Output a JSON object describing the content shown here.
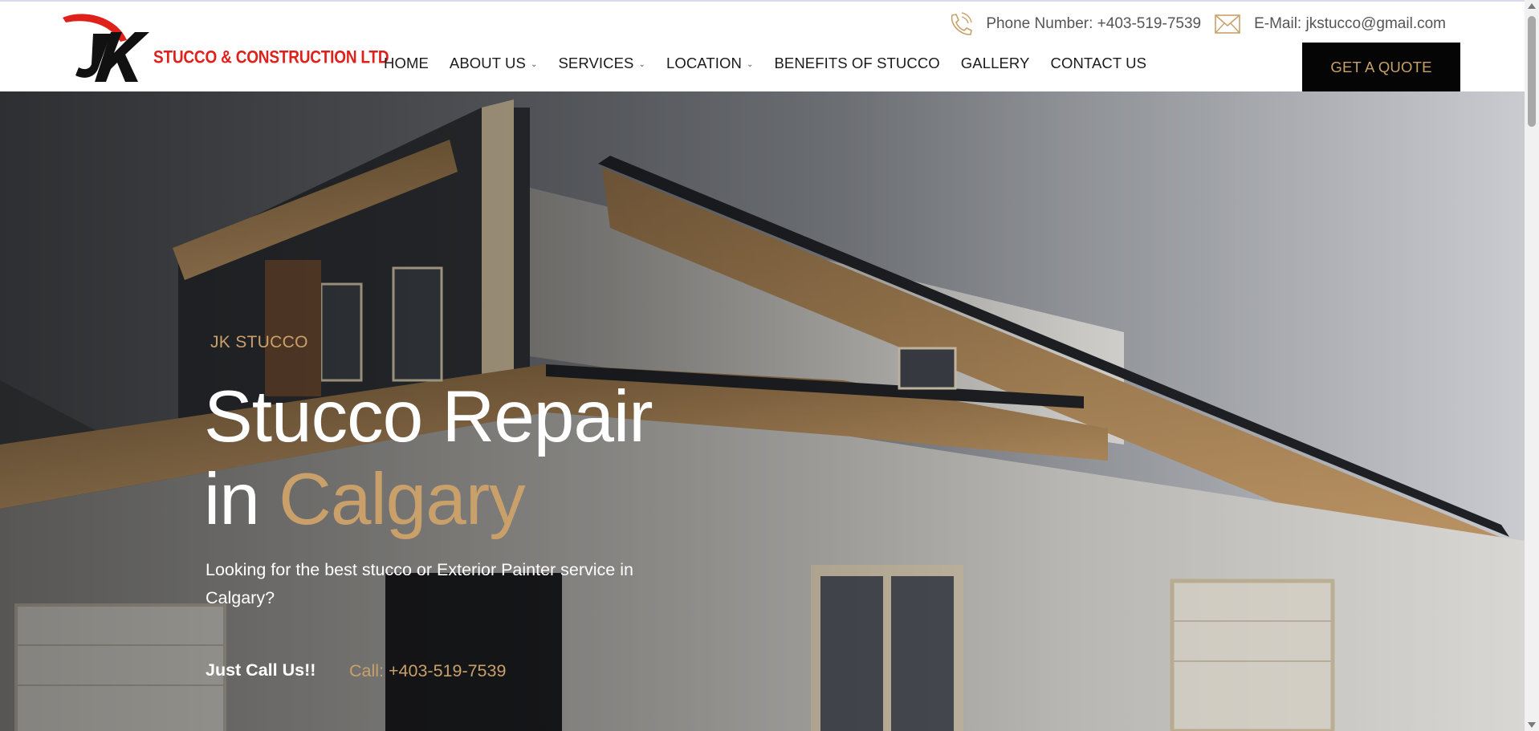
{
  "brand": {
    "logo_letters": "JK",
    "logo_tagline": "STUCCO & CONSTRUCTION LTD",
    "logo_color": "#e0211b"
  },
  "topbar": {
    "phone_icon": "phone-icon",
    "phone_text": "Phone Number: +403-519-7539",
    "email_icon": "mail-icon",
    "email_text": "E-Mail: jkstucco@gmail.com"
  },
  "nav": {
    "items": [
      {
        "label": "HOME",
        "dropdown": false
      },
      {
        "label": "ABOUT US",
        "dropdown": true
      },
      {
        "label": "SERVICES",
        "dropdown": true
      },
      {
        "label": "LOCATION",
        "dropdown": true
      },
      {
        "label": "BENEFITS OF STUCCO",
        "dropdown": false
      },
      {
        "label": "GALLERY",
        "dropdown": false
      },
      {
        "label": "CONTACT US",
        "dropdown": false
      }
    ],
    "cta_label": "GET A QUOTE"
  },
  "hero": {
    "eyebrow": "JK STUCCO",
    "headline_line1": "Stucco Repair",
    "headline_line2_prefix": "in ",
    "headline_line2_accent": "Calgary",
    "subtext": "Looking for the best stucco or Exterior Painter service in Calgary?",
    "call_lead": "Just Call Us!!",
    "call_number": "Call: +403-519-7539"
  },
  "colors": {
    "accent": "#c9a06a",
    "cta_background": "#050505",
    "text_dark": "#1b1b1b"
  }
}
